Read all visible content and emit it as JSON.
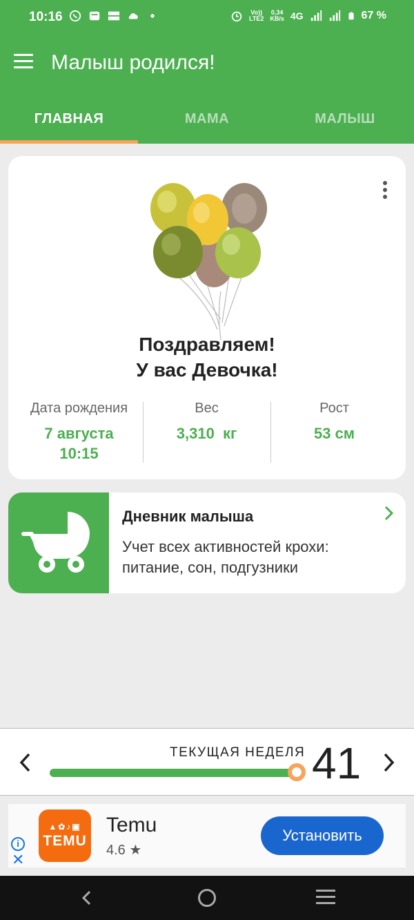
{
  "status_bar": {
    "time": "10:16",
    "network_speed_top": "0,34",
    "network_speed_bottom": "KB/s",
    "volte_top": "Vo))",
    "volte_bottom": "LTE2",
    "network_type": "4G",
    "battery": "67 %"
  },
  "app_bar": {
    "title": "Малыш родился!"
  },
  "tabs": [
    {
      "label": "ГЛАВНАЯ",
      "active": true
    },
    {
      "label": "МАМА",
      "active": false
    },
    {
      "label": "МАЛЫШ",
      "active": false
    }
  ],
  "main_card": {
    "congrats_line1": "Поздравляем!",
    "congrats_line2": "У вас Девочка!",
    "stats": [
      {
        "label": "Дата рождения",
        "value_line1": "7 августа",
        "value_line2": "10:15"
      },
      {
        "label": "Вес",
        "value_line1": "3,310  кг",
        "value_line2": ""
      },
      {
        "label": "Рост",
        "value_line1": "53 см",
        "value_line2": ""
      }
    ]
  },
  "diary_card": {
    "title": "Дневник малыша",
    "description": "Учет всех активностей крохи: питание, сон, подгузники"
  },
  "week_bar": {
    "label": "ТЕКУЩАЯ НЕДЕЛЯ",
    "week": "41",
    "progress_fraction": 0.99
  },
  "ad": {
    "app_name": "Temu",
    "rating": "4.6 ★",
    "logo_text": "TEMU",
    "install_label": "Установить"
  },
  "colors": {
    "primary": "#4caf50",
    "accent": "#f7a35c",
    "install_blue": "#1a66cf",
    "temu_orange": "#f56b0f"
  },
  "icons": [
    "whatsapp-icon",
    "mail-icon",
    "momlife-icon",
    "cloud-icon",
    "alarm-icon",
    "signal-icon",
    "battery-icon",
    "menu-icon",
    "more-vert-icon",
    "balloons-image",
    "stroller-icon",
    "chevron-right-icon",
    "chevron-left-icon",
    "info-icon",
    "close-icon",
    "nav-back-icon",
    "nav-home-icon",
    "nav-recents-icon"
  ]
}
